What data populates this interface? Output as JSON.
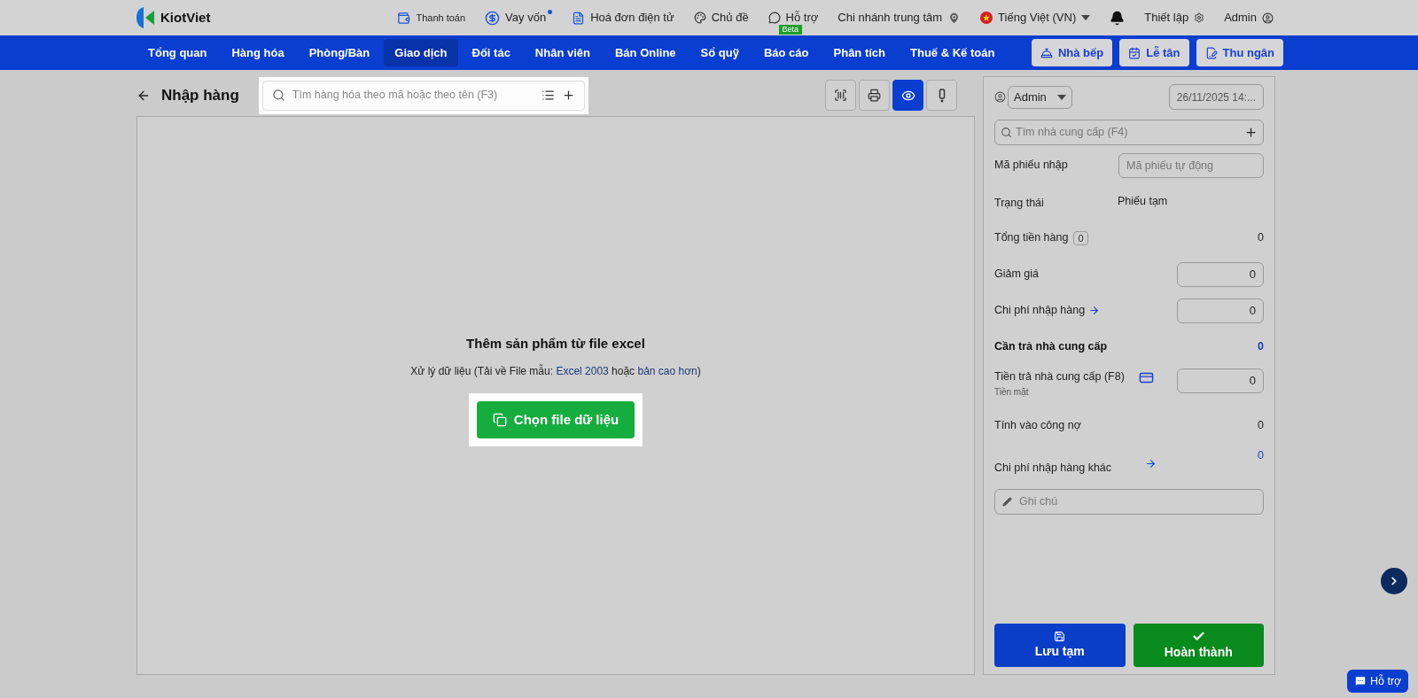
{
  "top_bar": {
    "logo": "KiotViet",
    "links": [
      {
        "label": "Thanh toán",
        "dot": false
      },
      {
        "label": "Vay vốn",
        "dot": true
      },
      {
        "label": "Hoá đơn điện tử",
        "dot": false
      },
      {
        "label": "Chủ đề",
        "dot": false
      },
      {
        "label": "Hỗ trợ",
        "dot": false,
        "badge": "Beta"
      },
      {
        "label": "Chi nhánh trung tâm",
        "dot": false
      },
      {
        "label": "Tiếng Việt (VN)",
        "dot": false
      },
      {
        "label": "Thiết lập",
        "dot": false
      },
      {
        "label": "Admin",
        "dot": false
      }
    ]
  },
  "nav": {
    "items": [
      {
        "label": "Tổng quan",
        "selected": false
      },
      {
        "label": "Hàng hóa",
        "selected": false
      },
      {
        "label": "Phòng/Bàn",
        "selected": false
      },
      {
        "label": "Giao dịch",
        "selected": true
      },
      {
        "label": "Đối tác",
        "selected": false
      },
      {
        "label": "Nhân viên",
        "selected": false
      },
      {
        "label": "Bán Online",
        "selected": false
      },
      {
        "label": "Sổ quỹ",
        "selected": false
      },
      {
        "label": "Báo cáo",
        "selected": false
      },
      {
        "label": "Phân tích",
        "selected": false
      },
      {
        "label": "Thuế & Kế toán",
        "selected": false
      }
    ],
    "buttons": [
      "Nhà bếp",
      "Lễ tân",
      "Thu ngân"
    ]
  },
  "header": {
    "title": "Nhập hàng",
    "search": {
      "placeholder": "Tìm hàng hóa theo mã hoặc theo tên (F3)"
    },
    "toolbar": [
      {
        "selected": false
      },
      {
        "selected": false
      },
      {
        "selected": true
      },
      {
        "selected": false
      }
    ]
  },
  "import": {
    "title": "Thêm sản phẩm từ file excel",
    "description": [
      {
        "kind": "text",
        "text": "Xử lý dữ liệu (Tải về File mẫu: "
      },
      {
        "kind": "link",
        "text": "Excel 2003"
      },
      {
        "kind": "text",
        "text": " hoặc "
      },
      {
        "kind": "link",
        "text": "bản cao hơn"
      },
      {
        "kind": "text",
        "text": ")"
      }
    ],
    "button": "Chọn file dữ liệu"
  },
  "side_panel": {
    "user": "Admin",
    "date": "26/11/2025 14:...",
    "supplier_search": {
      "placeholder": "Tìm nhà cung cấp (F4)"
    },
    "rows": [
      {
        "kind": "input",
        "label": "Mã phiếu nhập",
        "placeholder": "Mã phiếu tự động"
      },
      {
        "kind": "text",
        "label": "Trạng thái",
        "value": "Phiếu tạm"
      },
      {
        "kind": "total",
        "label": "Tổng tiền hàng",
        "badge": "0",
        "value": "0"
      },
      {
        "kind": "amount",
        "label": "Giảm giá",
        "value": "0"
      },
      {
        "kind": "amount_arrow",
        "label": "Chi phí nhập hàng",
        "value": "0"
      },
      {
        "kind": "emphasis",
        "label": "Cần trả nhà cung cấp",
        "value": "0"
      },
      {
        "kind": "payment",
        "label": "Tiền trả nhà cung cấp (F8)",
        "sublabel": "Tiền mặt",
        "value": "0"
      },
      {
        "kind": "plain",
        "label": "Tính vào công nợ",
        "value": "0"
      },
      {
        "kind": "link_value",
        "label": "Chi phí nhập hàng khác",
        "value": "0"
      }
    ],
    "note": {
      "placeholder": "Ghi chú"
    },
    "save_button": "Lưu tạm",
    "complete_button": "Hoàn thành"
  },
  "support_button": "Hỗ trợ"
}
